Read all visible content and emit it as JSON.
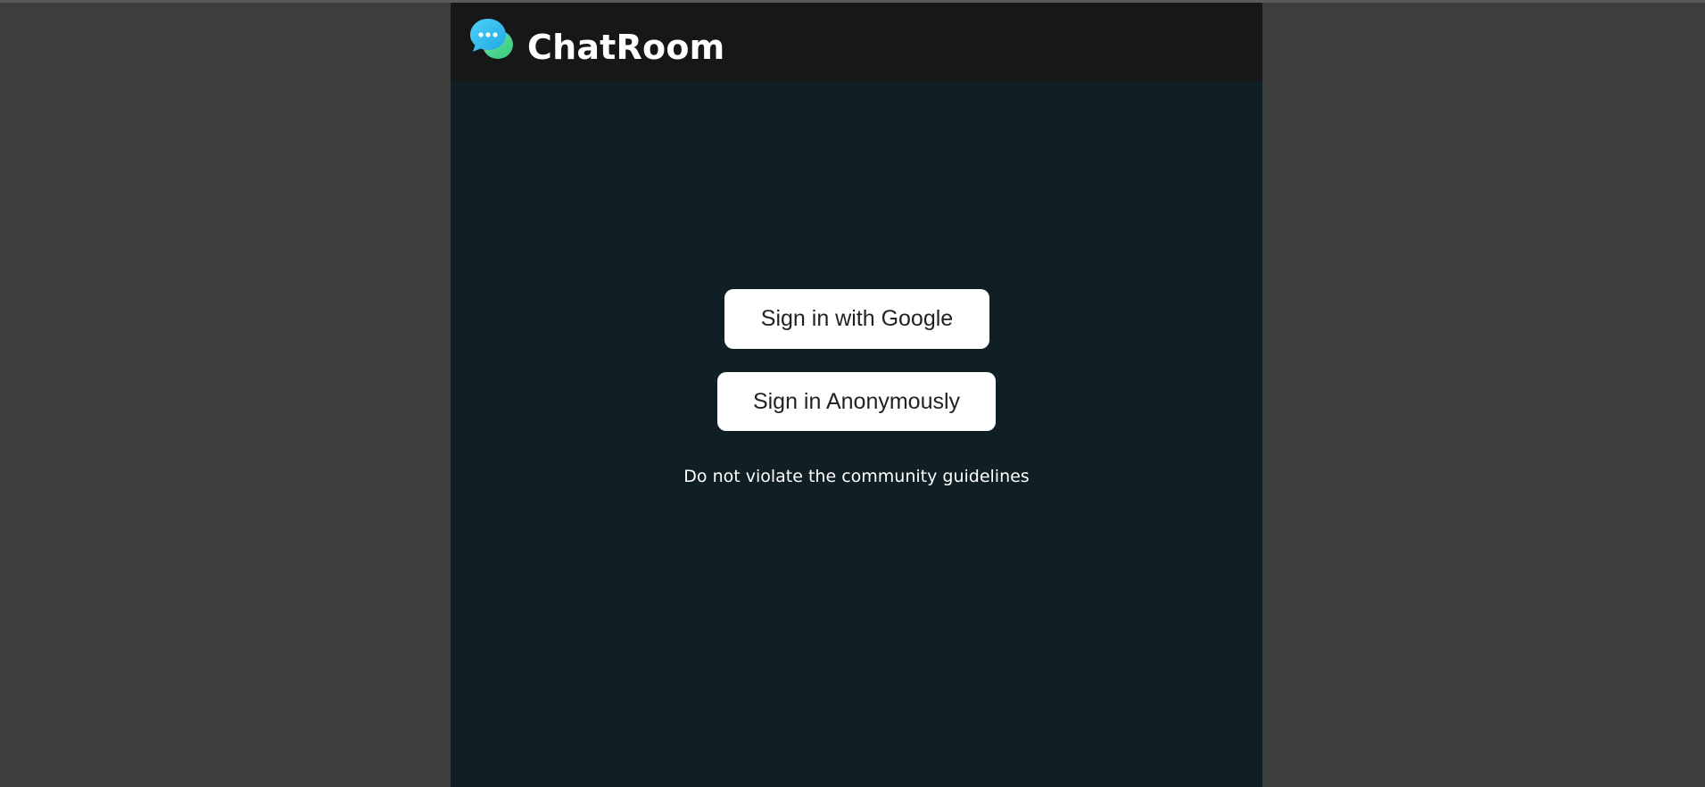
{
  "header": {
    "title": "ChatRoom",
    "logo_icon": "chat-bubble-icon",
    "logo_colors": [
      "#38bdf8",
      "#4ade80"
    ]
  },
  "auth": {
    "google_button_label": "Sign in with Google",
    "anonymous_button_label": "Sign in Anonymously"
  },
  "footer_note": "Do not violate the community guidelines",
  "colors": {
    "page_background": "#3d3d3d",
    "app_background": "#0f1f23",
    "header_background": "#171717",
    "button_background": "#ffffff",
    "button_text": "#222222"
  }
}
